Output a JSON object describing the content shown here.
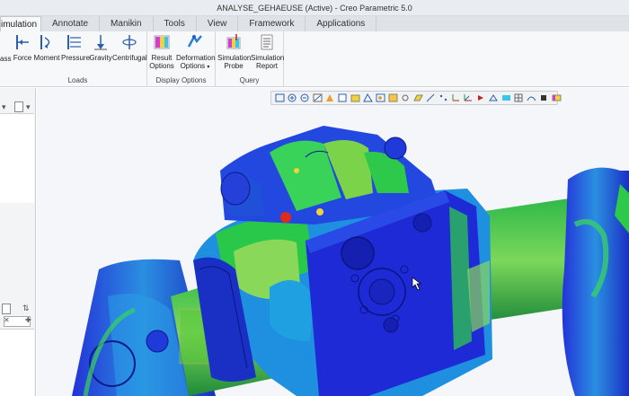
{
  "window": {
    "title": "ANALYSE_GEHAEUSE (Active) - Creo Parametric 5.0"
  },
  "tabs": [
    {
      "label": "imulation",
      "active": true
    },
    {
      "label": "Annotate"
    },
    {
      "label": "Manikin"
    },
    {
      "label": "Tools"
    },
    {
      "label": "View"
    },
    {
      "label": "Framework"
    },
    {
      "label": "Applications"
    }
  ],
  "ribbon": {
    "partial_label": "ass",
    "loads": {
      "label": "Loads",
      "buttons": [
        "Force",
        "Moment",
        "Pressure",
        "Gravity",
        "Centrifugal"
      ]
    },
    "display": {
      "label": "Display Options",
      "result_line1": "Result",
      "result_line2": "Options",
      "deform_line1": "Deformation",
      "deform_line2": "Options"
    },
    "query": {
      "label": "Query",
      "probe_line1": "Simulation",
      "probe_line2": "Probe",
      "report_line1": "Simulation",
      "report_line2": "Report"
    }
  },
  "colors": {
    "accent_blue": "#1f5fbf",
    "mesh_blue": "#1a2fd0",
    "mesh_green": "#3fbf3a",
    "mesh_red": "#e02a1a"
  }
}
